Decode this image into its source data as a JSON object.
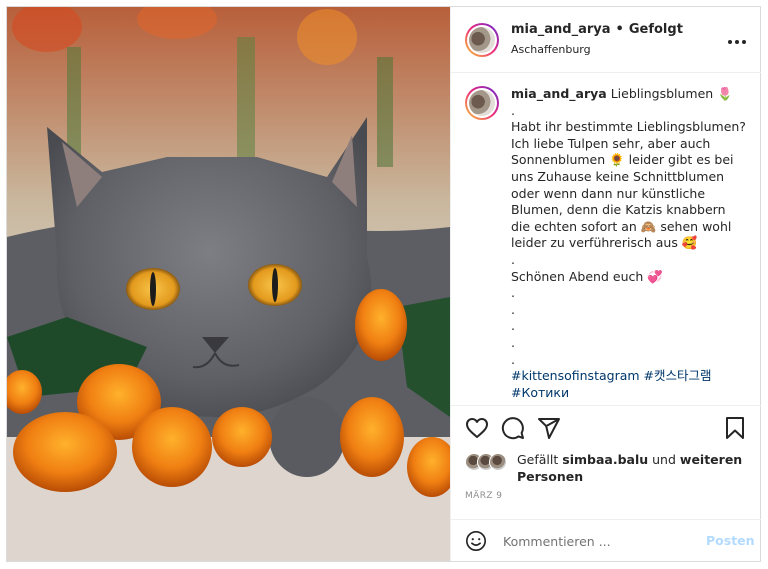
{
  "post": {
    "username": "mia_and_arya",
    "separator": "•",
    "follow_status": "Gefolgt",
    "location": "Aschaffenburg",
    "more_label": "•••"
  },
  "caption": {
    "username": "mia_and_arya",
    "lines": [
      "Lieblingsblumen 🌷",
      ".",
      "Habt ihr bestimmte Lieblingsblumen? Ich liebe Tulpen sehr, aber auch Sonnenblumen 🌻  leider gibt es bei uns Zuhause keine Schnittblumen oder wenn dann nur künstliche Blumen, denn die Katzis knabbern die echten sofort an 🙈  sehen wohl leider zu verführerisch aus 🥰",
      ".",
      "Schönen Abend euch 💞",
      ".",
      ".",
      ".",
      ".",
      ".",
      ""
    ],
    "hashtags": [
      "#kittensofinstagram",
      "#캣스타그램",
      "#Котики"
    ]
  },
  "actions": {
    "like_icon": "heart-icon",
    "comment_icon": "speech-bubble-icon",
    "share_icon": "paper-plane-icon",
    "save_icon": "bookmark-icon"
  },
  "likes": {
    "prefix": "Gefällt ",
    "user": "simbaa.balu",
    "middle": " und ",
    "others": "weiteren Personen"
  },
  "date": "MÄRZ 9",
  "comment_box": {
    "emoji_icon": "smiley-icon",
    "placeholder": "Kommentieren ...",
    "post_label": "Posten"
  },
  "colors": {
    "link": "#00376b",
    "post_button_disabled": "#b3dbff",
    "border": "#dbdbdb"
  }
}
